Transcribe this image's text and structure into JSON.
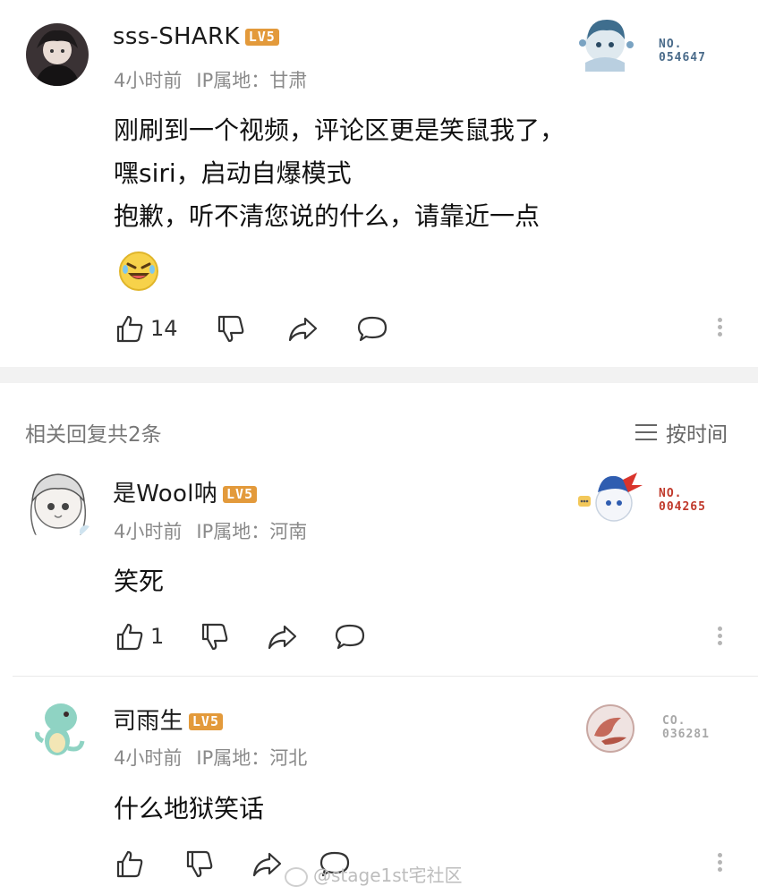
{
  "main_comment": {
    "username": "sss-SHARK",
    "level": "LV5",
    "time": "4小时前",
    "ip_location": "IP属地：甘肃",
    "badge_no_label": "NO.",
    "badge_number": "054647",
    "lines": [
      "刚刷到一个视频，评论区更是笑鼠我了，",
      "嘿siri，启动自爆模式",
      "抱歉，听不清您说的什么，请靠近一点"
    ],
    "emoji": "laughing-emoji",
    "likes": "14"
  },
  "replies_header": {
    "title": "相关回复共2条",
    "sort_label": "按时间"
  },
  "replies": [
    {
      "username": "是Wool呐",
      "level": "LV5",
      "time": "4小时前",
      "ip_location": "IP属地：河南",
      "badge_no_label": "NO.",
      "badge_number": "004265",
      "text": "笑死",
      "likes": "1"
    },
    {
      "username": "司雨生",
      "level": "LV5",
      "time": "4小时前",
      "ip_location": "IP属地：河北",
      "badge_no_label": "CO.",
      "badge_number": "036281",
      "text": "什么地狱笑话",
      "likes": ""
    }
  ],
  "watermark": "@stage1st宅社区",
  "colors": {
    "level_badge": "#e39a3b",
    "badge1": "#4a6b8a",
    "badge2": "#c0392b",
    "badge3": "#a8a8a8"
  }
}
